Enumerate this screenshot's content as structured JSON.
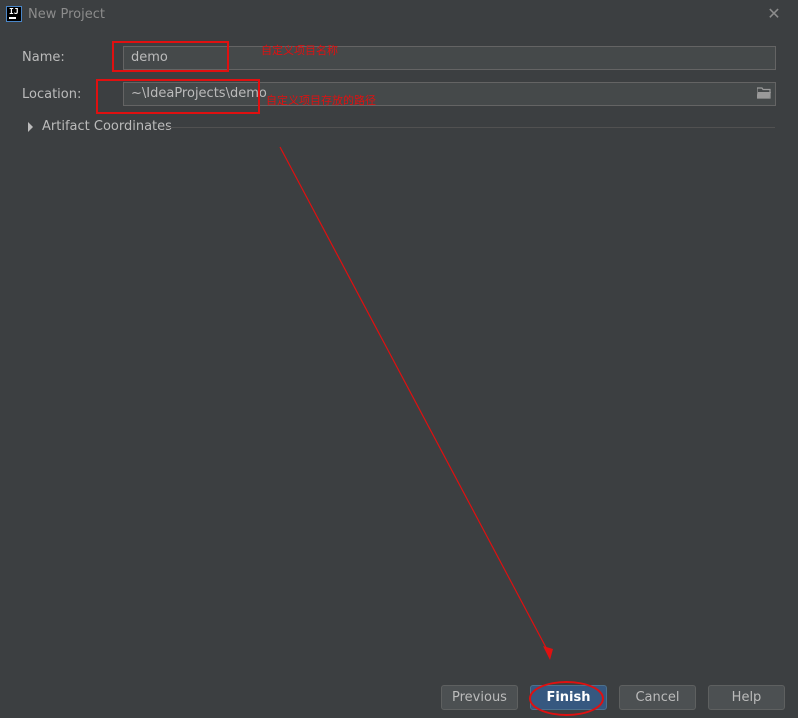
{
  "window": {
    "title": "New Project",
    "icon": "intellij-idea-icon",
    "close_icon": "close-icon"
  },
  "form": {
    "name_label": "Name:",
    "name_value": "demo",
    "location_label": "Location:",
    "location_value": "~\\IdeaProjects\\demo",
    "browse_icon": "folder-icon"
  },
  "artifact": {
    "label": "Artifact Coordinates",
    "expanded": false
  },
  "buttons": {
    "previous": "Previous",
    "finish": "Finish",
    "cancel": "Cancel",
    "help": "Help"
  },
  "annotations": {
    "name_note": "自定义项目名称",
    "location_note": "自定义项目存放的路径",
    "color": "#e01010"
  },
  "colors": {
    "background": "#3c3f41",
    "field_background": "#45494a",
    "primary_button": "#365880",
    "text": "#bbbbbb"
  }
}
